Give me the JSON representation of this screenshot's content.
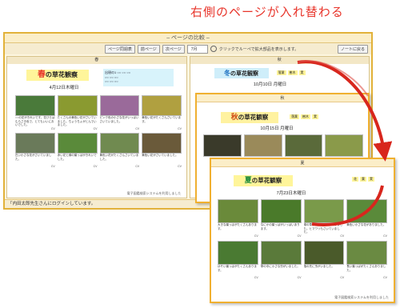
{
  "caption": "右側のページが入れ替わる",
  "window": {
    "title": "– ページの比較 –",
    "toolbar": {
      "btn_this_week": "ページ同週表",
      "btn_prev": "前ページ",
      "btn_next": "次ページ",
      "select_value": "7月",
      "description": "クリックでルーペで拡大部品を表示します。",
      "btn_notebook": "ノートに戻る"
    },
    "left_label": "春",
    "right_label": "秋",
    "status": "「内田太郎先生さんにログインしています。"
  },
  "spring": {
    "title_big": "春",
    "title_rest": "の草花観察",
    "date": "4月12日木曜日",
    "info": "出現の1 ○○ ○○ ○○\n○○ ○○ ○○\n○○ ○○ ○○",
    "footnote": "電子図鑑検索システムを利用しました",
    "cells": [
      {
        "photo_color": "#4a7a3a",
        "text": "○○の花がきれいです。花びらはむらさき色で、とてもいいにおいでした。",
        "tag": "CV"
      },
      {
        "photo_color": "#8a9a30",
        "text": "たくさんの黄色い花がさいていました。ちょうちょがとんでいました。",
        "tag": "CV"
      },
      {
        "photo_color": "#9a6a9a",
        "text": "ピンク色の小さな花がいっぱいさいていました。",
        "tag": "CV"
      },
      {
        "photo_color": "#b0a040",
        "text": "黄色い花がたくさんさいています。",
        "tag": "CV"
      },
      {
        "photo_color": "#6a7a5a",
        "text": "白い小さな花がさいていました。",
        "tag": "CV"
      },
      {
        "photo_color": "#5a8a3a",
        "text": "赤い花と緑の葉っぱがきれいでした。",
        "tag": "CV"
      },
      {
        "photo_color": "#708a50",
        "text": "黄色い花がたくさんさいていました。",
        "tag": "CV"
      },
      {
        "photo_color": "#6a5a3a",
        "text": "黄色い花がさいていました。",
        "tag": "CV"
      }
    ]
  },
  "winter": {
    "title_big": "冬",
    "title_rest": "の草花観察",
    "date": "10月10日 月曜日",
    "legend": [
      "落葉",
      "樹木",
      "実"
    ]
  },
  "autumn": {
    "header": "秋",
    "title_big": "秋",
    "title_rest": "の草花観察",
    "date": "10月15日 月曜日",
    "legend": [
      "落葉",
      "樹木",
      "実"
    ],
    "cells": [
      {
        "photo_color": "#3a3a2a"
      },
      {
        "photo_color": "#9a8a5a"
      },
      {
        "photo_color": "#5a6a3a"
      },
      {
        "photo_color": "#8a9a4a"
      }
    ]
  },
  "summer": {
    "header": "夏",
    "title_big": "夏",
    "title_rest": "の草花観察",
    "date": "7月23日木曜日",
    "legend": [
      "花",
      "葉",
      "実"
    ],
    "footnote": "電子図鑑検索システムを利用しました",
    "cells": [
      {
        "photo_color": "#6a8a3a",
        "text": "大きな葉っぱがたくさんあります。",
        "tag": "CV"
      },
      {
        "photo_color": "#4a7a2a",
        "text": "なにかの葉っぱがいっぱいあります。",
        "tag": "CV"
      },
      {
        "photo_color": "#7a9a4a",
        "text": "緑の草がたくさんはえていました。ヒマワリもさいていました。",
        "tag": "CV"
      },
      {
        "photo_color": "#5a8a3a",
        "text": "黄色い小さな花がありました。",
        "tag": "CV"
      },
      {
        "photo_color": "#4a7a32",
        "text": "ほそい葉っぱがたくさんあります。",
        "tag": "CV"
      },
      {
        "photo_color": "#5a7a3a",
        "text": "草の中に小さな虫がいました。",
        "tag": "CV"
      },
      {
        "photo_color": "#4a5a2a",
        "text": "指の先に虫がいました。",
        "tag": "CV"
      },
      {
        "photo_color": "#6a8a42",
        "text": "長い葉っぱがたくさんありました。",
        "tag": "CV"
      }
    ]
  },
  "colors": {
    "accent": "#e8352b",
    "frame": "#f0b030",
    "highlight": "#fff59a"
  }
}
